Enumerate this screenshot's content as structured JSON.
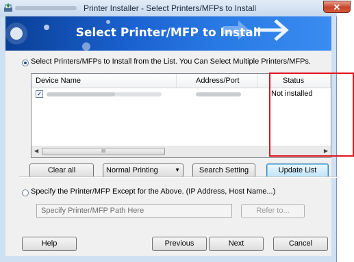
{
  "window": {
    "title": "Printer Installer - Select Printers/MFPs to Install",
    "close_label": "✕"
  },
  "banner": {
    "title": "Select Printer/MFP to Install"
  },
  "options": {
    "select_from_list": "Select Printers/MFPs to Install from the List. You Can Select Multiple Printers/MFPs.",
    "specify_other": "Specify the Printer/MFP Except for the Above. (IP Address, Host Name...)"
  },
  "list": {
    "columns": [
      "Device Name",
      "Address/Port",
      "Status"
    ],
    "rows": [
      {
        "checked": true,
        "status": "Not installed"
      }
    ],
    "scroll_thumb": "III"
  },
  "controls": {
    "clear_all": "Clear all",
    "printing_mode": "Normal Printing",
    "search_setting": "Search Setting",
    "update_list": "Update List"
  },
  "path": {
    "placeholder": "Specify Printer/MFP Path Here",
    "refer": "Refer to..."
  },
  "footer": {
    "help": "Help",
    "previous": "Previous",
    "next": "Next",
    "cancel": "Cancel"
  },
  "icons": {
    "app": "printer-install-icon",
    "banner": "arrow-right-icon",
    "dropdown": "chevron-down-icon"
  },
  "colors": {
    "banner": "#1b63d2",
    "highlight": "#e0141e"
  }
}
